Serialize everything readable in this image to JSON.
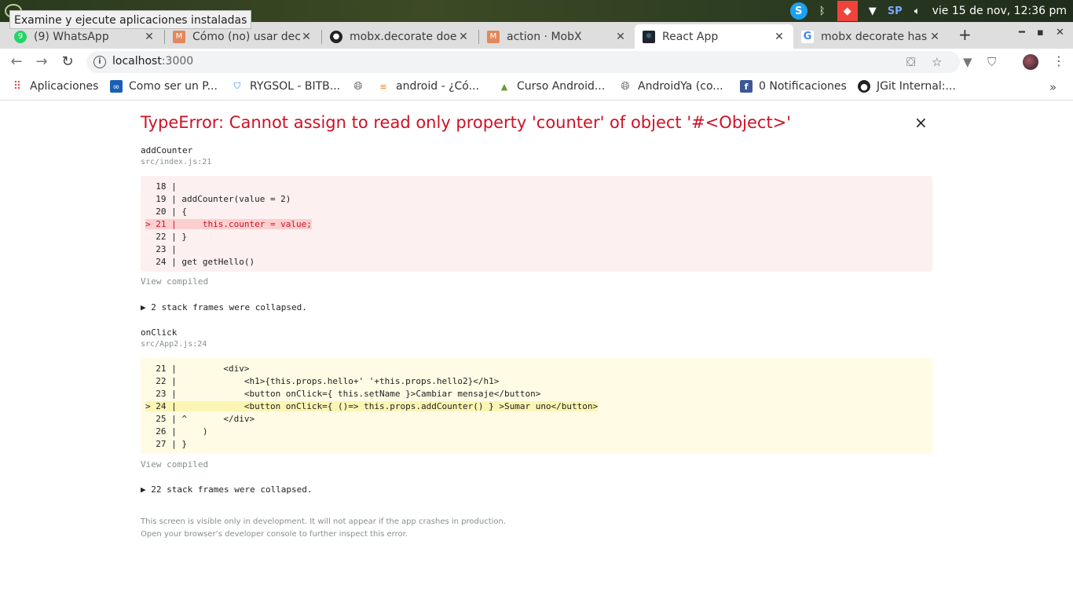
{
  "os": {
    "tooltip": "Examine y ejecute aplicaciones instaladas",
    "clock": "vie 15 de nov, 12:36 pm",
    "sp_label": "SP"
  },
  "tabs": [
    {
      "title": "(9) WhatsApp",
      "icon": "whatsapp-icon",
      "color": "#25d366"
    },
    {
      "title": "Cómo (no) usar decorators",
      "icon": "mobx-icon",
      "color": "#e4875b"
    },
    {
      "title": "mobx.decorate does",
      "icon": "github-icon",
      "color": "#222222"
    },
    {
      "title": "action · MobX",
      "icon": "mobx-icon",
      "color": "#e4875b"
    },
    {
      "title": "React App",
      "icon": "react-icon",
      "color": "#20232a"
    },
    {
      "title": "mobx decorate has",
      "icon": "google-icon",
      "color": "#4285f4"
    }
  ],
  "address": {
    "host": "localhost",
    "port": ":3000"
  },
  "bookmarks": [
    {
      "label": "Aplicaciones",
      "icon": "apps-grid-icon"
    },
    {
      "label": "Como ser un P...",
      "icon": "infinity-icon"
    },
    {
      "label": "RYGSOL - BITB...",
      "icon": "bitbucket-icon"
    },
    {
      "label": "",
      "icon": "globe-icon"
    },
    {
      "label": "android - ¿Có...",
      "icon": "stackoverflow-icon"
    },
    {
      "label": "Curso Android...",
      "icon": "landscape-icon"
    },
    {
      "label": "AndroidYa (co...",
      "icon": "globe-icon"
    },
    {
      "label": "0 Notificaciones",
      "icon": "facebook-icon"
    },
    {
      "label": "JGit Internal:...",
      "icon": "github-icon"
    }
  ],
  "error": {
    "title": "TypeError: Cannot assign to read only property 'counter' of object '#<Object>'",
    "close": "×",
    "frame1": {
      "function": "addCounter",
      "location": "src/index.js:21",
      "lines": [
        "  18 |",
        "  19 | addCounter(value = 2)",
        "  20 | {",
        "> 21 |     this.counter = value;",
        "  22 | }",
        "  23 |",
        "  24 | get getHello()"
      ],
      "view_compiled": "View compiled",
      "collapsed": "▶ 2 stack frames were collapsed."
    },
    "frame2": {
      "function": "onClick",
      "location": "src/App2.js:24",
      "lines": [
        "  21 |         <div>",
        "  22 |             <h1>{this.props.hello+' '+this.props.hello2}</h1>",
        "  23 |             <button onClick={ this.setName }>Cambiar mensaje</button>",
        "> 24 |             <button onClick={ ()=> this.props.addCounter() } >Sumar uno</button>",
        "  25 | ^       </div>",
        "  26 |     )",
        "  27 | }"
      ],
      "view_compiled": "View compiled",
      "collapsed": "▶ 22 stack frames were collapsed."
    },
    "footer_line1": "This screen is visible only in development. It will not appear if the app crashes in production.",
    "footer_line2": "Open your browser’s developer console to further inspect this error."
  }
}
